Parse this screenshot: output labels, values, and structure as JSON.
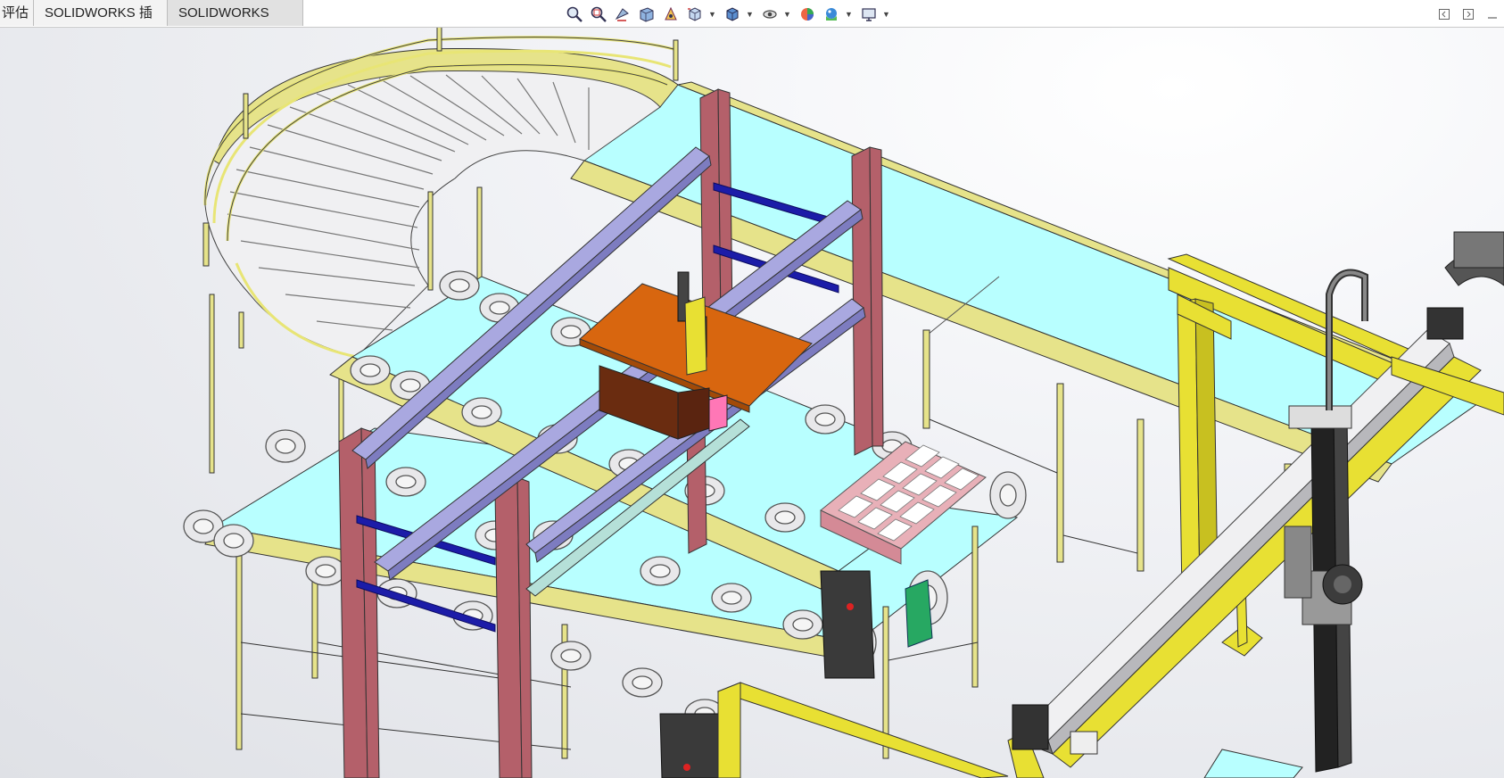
{
  "window": {
    "tabs": [
      {
        "label": "评估",
        "active": false
      },
      {
        "label": "SOLIDWORKS 插件",
        "active": false
      },
      {
        "label": "SOLIDWORKS MBD",
        "active": true
      }
    ]
  },
  "view_toolbar": {
    "icons": [
      "zoom-to-fit-icon",
      "zoom-to-area-icon",
      "previous-view-icon",
      "section-view-icon",
      "dynamic-annotation-icon",
      "view-orientation-icon",
      "display-style-icon",
      "hide-show-items-icon",
      "edit-appearance-icon",
      "apply-scene-icon",
      "view-settings-icon"
    ]
  },
  "window_controls": [
    "restore-left-icon",
    "restore-right-icon",
    "minimize-icon"
  ],
  "model": {
    "colors": {
      "frame": "#e6e38a",
      "belt": "#b8ffff",
      "post": "#b4606a",
      "rail": "#a9a8e0",
      "crossbar": "#1c1ca8",
      "plate": "#d8660f",
      "gantry": "#e8e033",
      "roller": "#e8e8ea",
      "tray": "#e8b0b8"
    }
  }
}
